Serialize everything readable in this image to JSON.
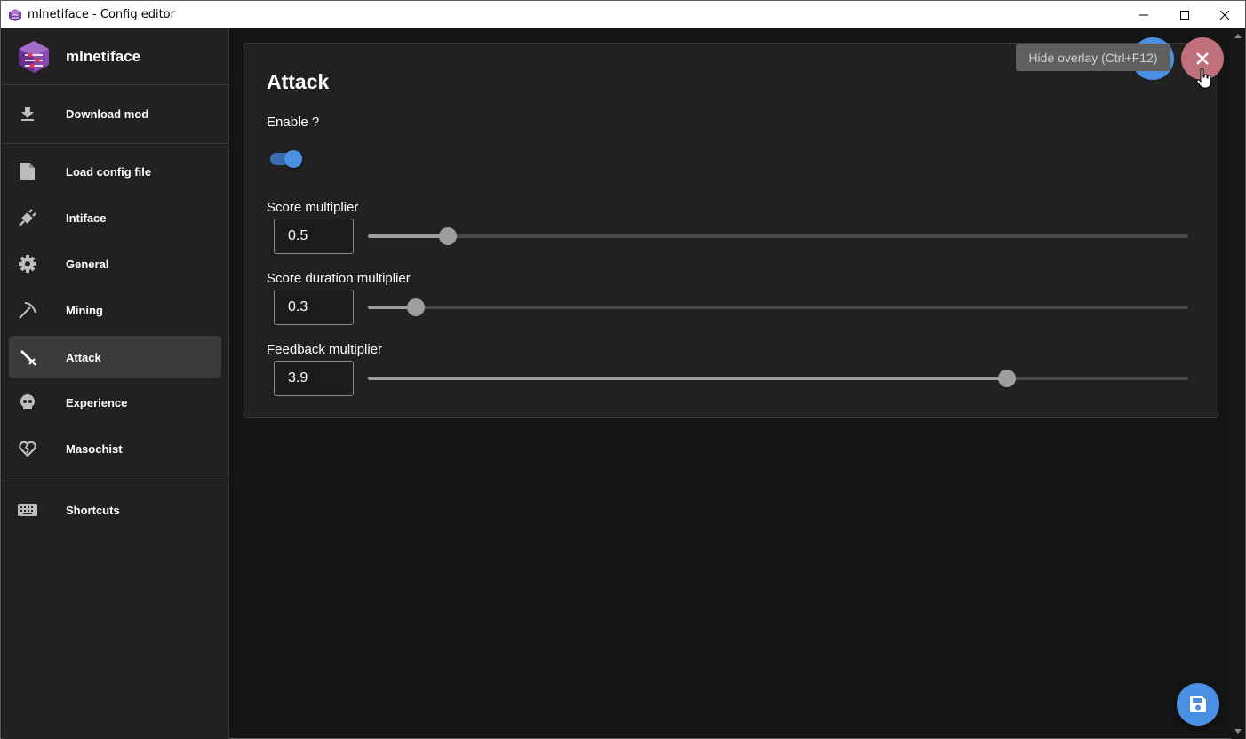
{
  "window": {
    "title": "mlnetiface - Config editor",
    "minimize_icon": "minimize-icon",
    "maximize_icon": "maximize-icon",
    "close_icon": "close-icon"
  },
  "sidebar": {
    "brand": "mlnetiface",
    "top_item": {
      "label": "Download mod",
      "icon": "download-icon"
    },
    "items": [
      {
        "label": "Load config file",
        "icon": "file-icon"
      },
      {
        "label": "Intiface",
        "icon": "plug-icon"
      },
      {
        "label": "General",
        "icon": "gear-icon"
      },
      {
        "label": "Mining",
        "icon": "pickaxe-icon"
      },
      {
        "label": "Attack",
        "icon": "sword-icon",
        "active": true
      },
      {
        "label": "Experience",
        "icon": "skull-icon"
      },
      {
        "label": "Masochist",
        "icon": "broken-heart-icon"
      }
    ],
    "bottom_item": {
      "label": "Shortcuts",
      "icon": "keyboard-icon"
    }
  },
  "panel": {
    "title": "Attack",
    "enable_label": "Enable ?",
    "enabled": true,
    "fields": [
      {
        "label": "Score multiplier",
        "value": "0.5",
        "fraction": 0.098
      },
      {
        "label": "Score duration multiplier",
        "value": "0.3",
        "fraction": 0.058
      },
      {
        "label": "Feedback multiplier",
        "value": "3.9",
        "fraction": 0.779
      }
    ]
  },
  "overlay": {
    "tooltip": "Hide overlay (Ctrl+F12)",
    "close_icon": "close-icon",
    "save_icon": "save-icon"
  },
  "colors": {
    "accent": "#4a90e2",
    "close_button": "#c0707a",
    "sidebar_bg": "#212121",
    "main_bg": "#141414"
  }
}
